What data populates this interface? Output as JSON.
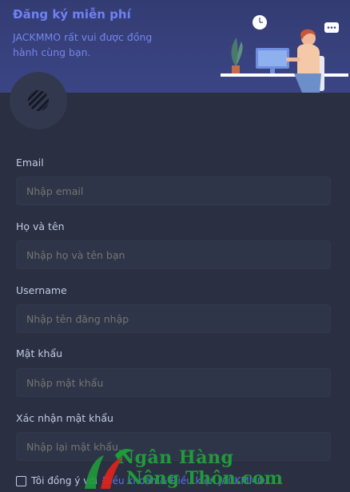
{
  "header": {
    "title": "Đăng ký miễn phí",
    "subtitle": "JACKMMO rất vui được đồng hành cùng bạn."
  },
  "form": {
    "email": {
      "label": "Email",
      "placeholder": "Nhập email"
    },
    "fullname": {
      "label": "Họ và tên",
      "placeholder": "Nhập họ và tên bạn"
    },
    "username": {
      "label": "Username",
      "placeholder": "Nhập tên đăng nhập"
    },
    "password": {
      "label": "Mật khẩu",
      "placeholder": "Nhập mật khẩu"
    },
    "confirm_password": {
      "label": "Xác nhận mật khẩu",
      "placeholder": "Nhập lại mật khẩu"
    }
  },
  "terms": {
    "prefix": "Tôi đồng ý với",
    "link": "Điều khoản & Điều kiện JACKMMO"
  },
  "watermark": {
    "line1": "Ngân Hàng",
    "line2": "Nông Thôn.com"
  },
  "colors": {
    "background": "#2a3042",
    "header": "#3b4585",
    "accent": "#6f81f4",
    "watermark": "#1f9b3a"
  },
  "icons": {
    "logo": "striped-logo-icon",
    "illustration": "person-at-desk-illustration"
  }
}
